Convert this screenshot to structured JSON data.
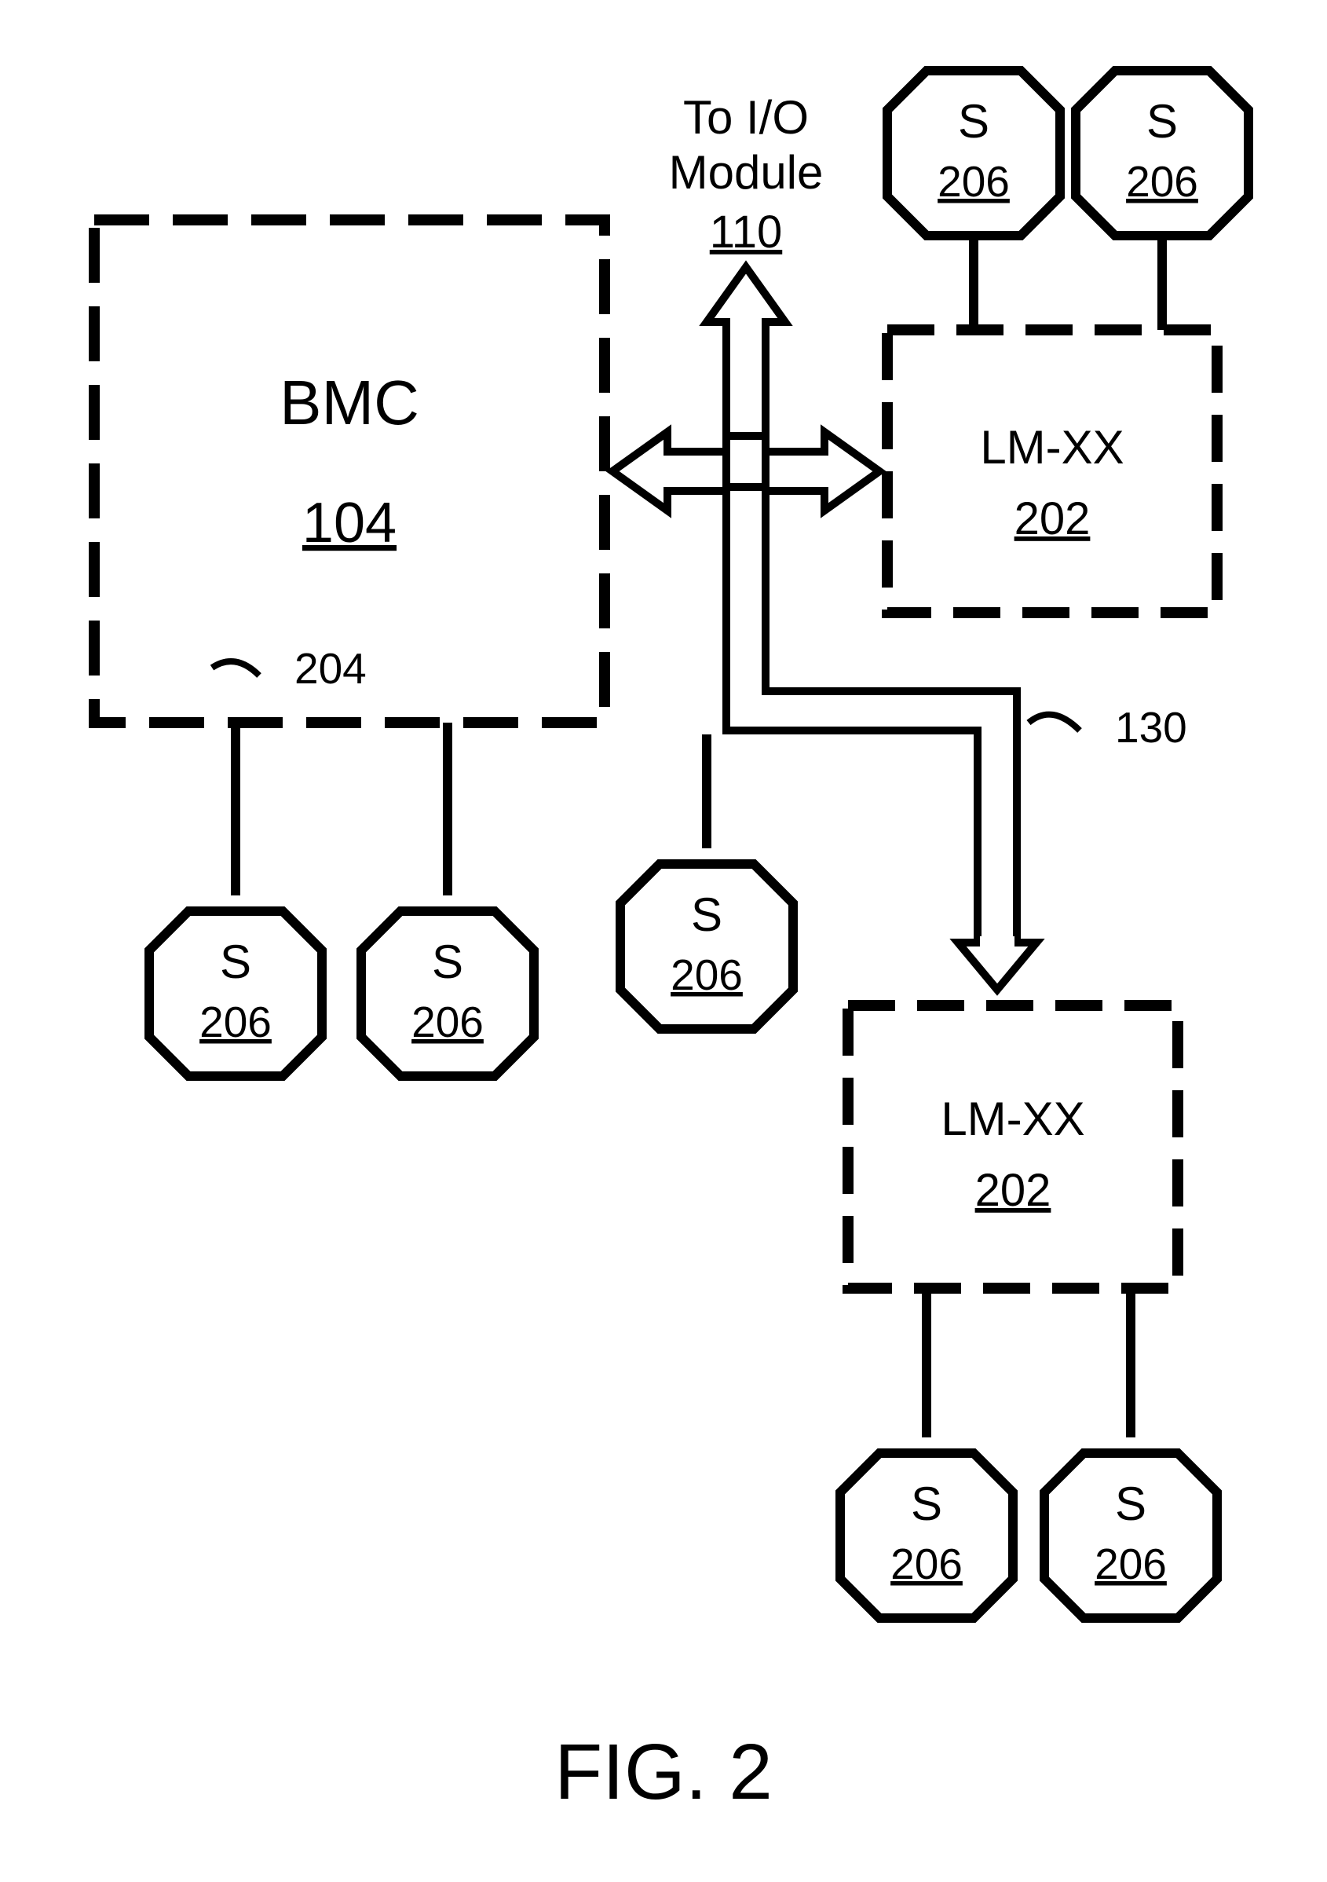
{
  "figure_caption": "FIG. 2",
  "io_label_line1": "To I/O",
  "io_label_line2": "Module",
  "io_label_num": "110",
  "bmc": {
    "label": "BMC",
    "num": "104"
  },
  "lmxx_top": {
    "label": "LM-XX",
    "num": "202"
  },
  "lmxx_bot": {
    "label": "LM-XX",
    "num": "202"
  },
  "sensor": {
    "label": "S",
    "num": "206"
  },
  "callout_204": "204",
  "callout_130": "130"
}
